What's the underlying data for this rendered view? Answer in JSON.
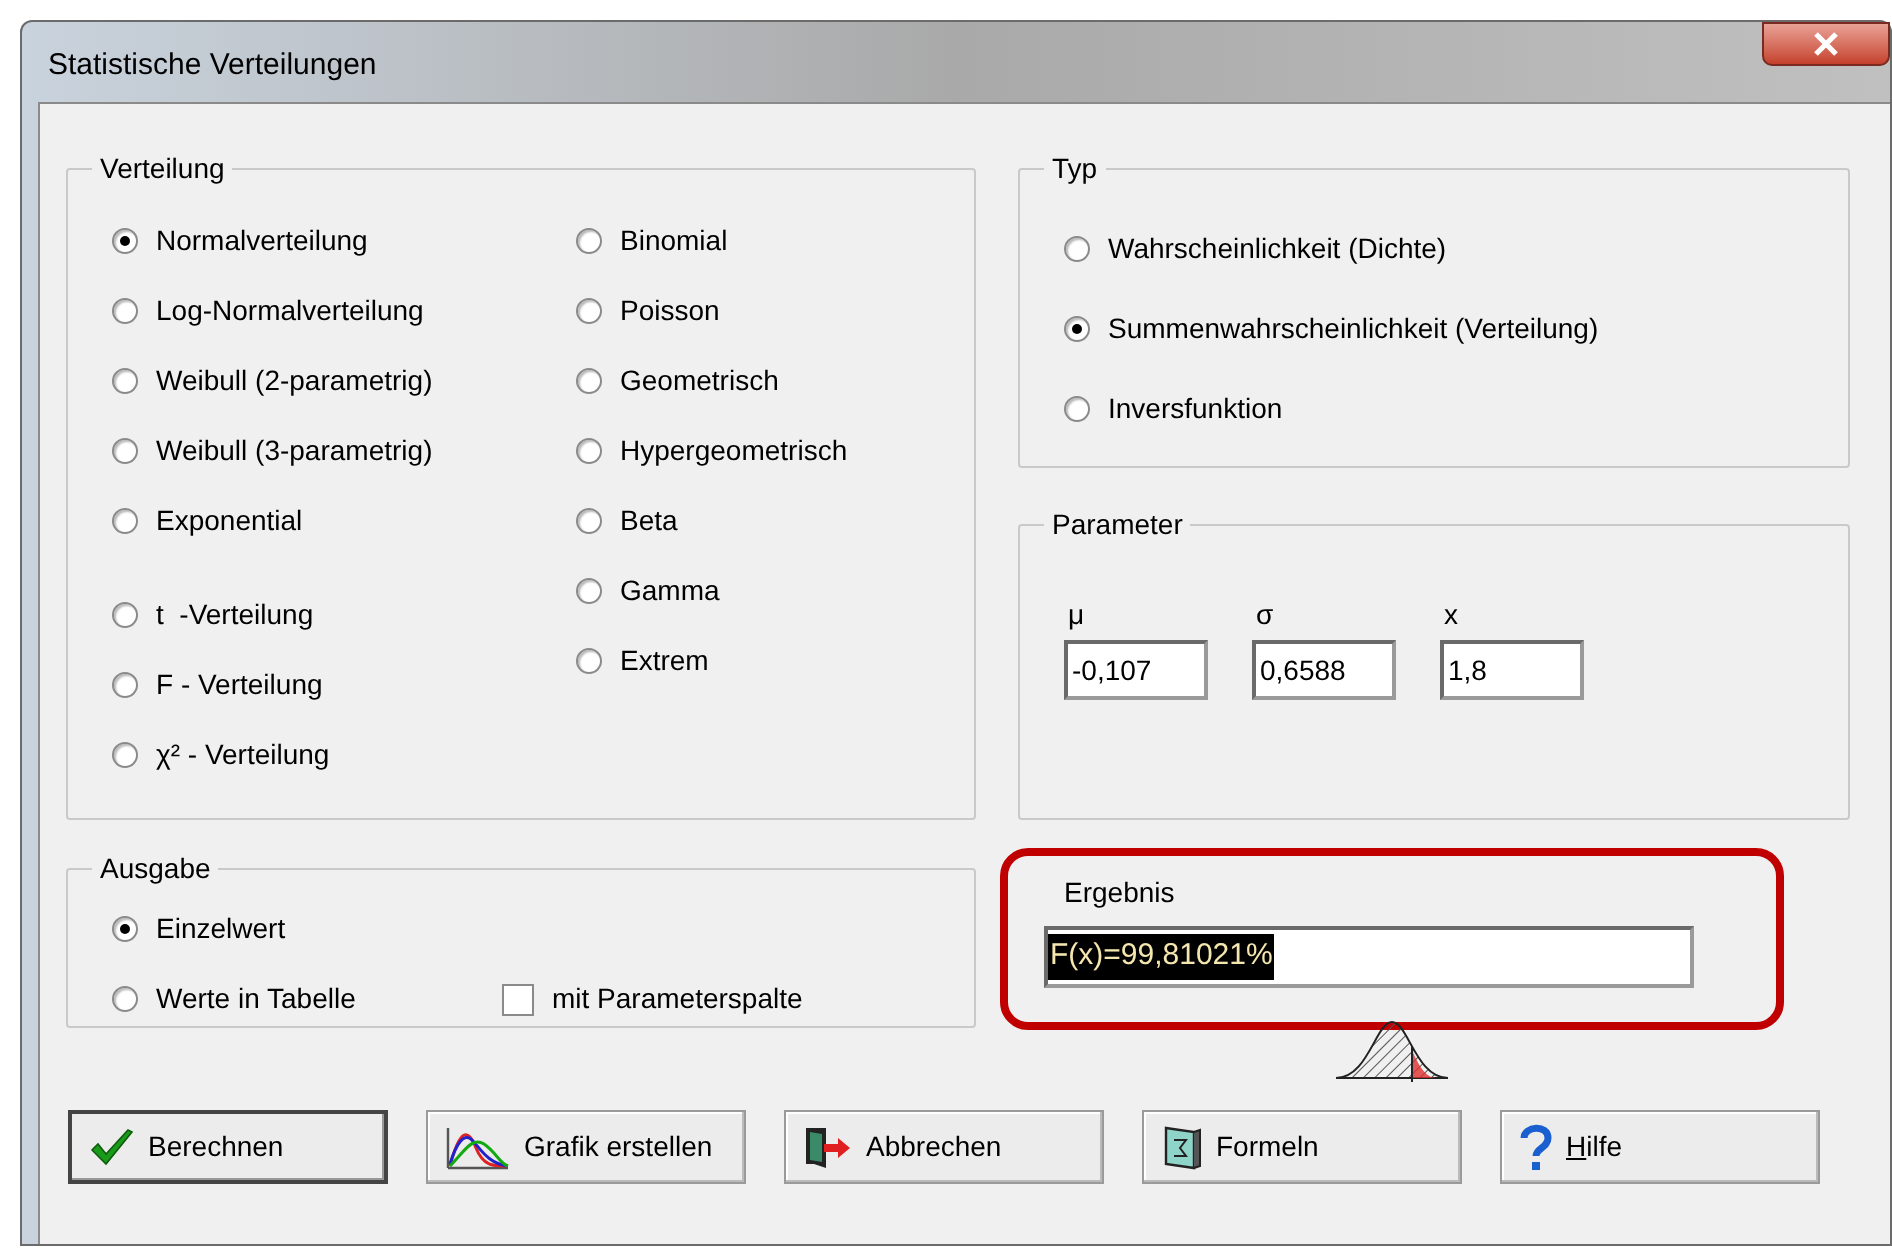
{
  "window": {
    "title": "Statistische Verteilungen"
  },
  "verteilung": {
    "label": "Verteilung",
    "columns": [
      [
        {
          "label": "Normalverteilung",
          "selected": true
        },
        {
          "label": "Log-Normalverteilung",
          "selected": false
        },
        {
          "label": "Weibull (2-parametrig)",
          "selected": false
        },
        {
          "label": "Weibull (3-parametrig)",
          "selected": false
        },
        {
          "label": "Exponential",
          "selected": false
        },
        {
          "label": "t  -Verteilung",
          "selected": false
        },
        {
          "label": "F - Verteilung",
          "selected": false
        },
        {
          "label": "χ² - Verteilung",
          "selected": false
        }
      ],
      [
        {
          "label": "Binomial",
          "selected": false
        },
        {
          "label": "Poisson",
          "selected": false
        },
        {
          "label": "Geometrisch",
          "selected": false
        },
        {
          "label": "Hypergeometrisch",
          "selected": false
        },
        {
          "label": "Beta",
          "selected": false
        },
        {
          "label": "Gamma",
          "selected": false
        },
        {
          "label": "Extrem",
          "selected": false
        }
      ]
    ]
  },
  "typ": {
    "label": "Typ",
    "options": [
      {
        "label": "Wahrscheinlichkeit (Dichte)",
        "selected": false
      },
      {
        "label": "Summenwahrscheinlichkeit (Verteilung)",
        "selected": true
      },
      {
        "label": "Inversfunktion",
        "selected": false
      }
    ]
  },
  "parameter": {
    "label": "Parameter",
    "fields": [
      {
        "label": "μ",
        "value": "-0,107"
      },
      {
        "label": "σ",
        "value": "0,6588"
      },
      {
        "label": "x",
        "value": "1,8"
      }
    ]
  },
  "ausgabe": {
    "label": "Ausgabe",
    "options": [
      {
        "label": "Einzelwert",
        "selected": true
      },
      {
        "label": "Werte in Tabelle",
        "selected": false
      }
    ],
    "checkbox": {
      "label": "mit Parameterspalte",
      "checked": false
    }
  },
  "ergebnis": {
    "label": "Ergebnis",
    "value": "F(x)=99,81021%",
    "text_selected": true
  },
  "buttons": [
    {
      "label": "Berechnen",
      "kind": "check",
      "default": true
    },
    {
      "label": "Grafik erstellen",
      "kind": "chart",
      "default": false
    },
    {
      "label": "Abbrechen",
      "kind": "exit",
      "default": false
    },
    {
      "label": "Formeln",
      "kind": "book",
      "default": false
    },
    {
      "label": "Hilfe",
      "kind": "help",
      "default": false,
      "underline_first": true
    }
  ]
}
